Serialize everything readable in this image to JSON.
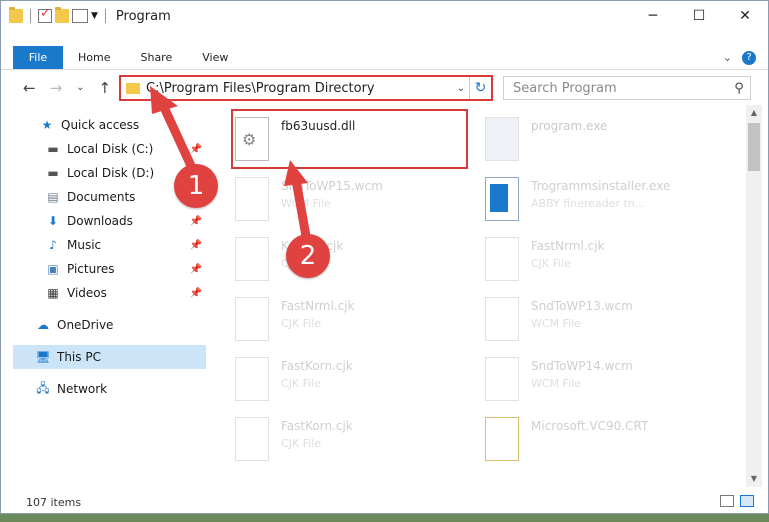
{
  "window": {
    "title": "Program",
    "controls": {
      "minimize": "─",
      "maximize": "☐",
      "close": "✕"
    }
  },
  "ribbon": {
    "tabs": [
      "File",
      "Home",
      "Share",
      "View"
    ],
    "expand_glyph": "⌄",
    "help_glyph": "?"
  },
  "address": {
    "path": "C:\\Program Files\\Program Directory",
    "search_placeholder": "Search Program"
  },
  "sidebar": {
    "items": [
      {
        "label": "Quick access",
        "icon": "star-icon",
        "pinned": false
      },
      {
        "label": "Local Disk (C:)",
        "icon": "drive-icon",
        "pinned": true
      },
      {
        "label": "Local Disk (D:)",
        "icon": "drive-icon",
        "pinned": false
      },
      {
        "label": "Documents",
        "icon": "documents-icon",
        "pinned": true
      },
      {
        "label": "Downloads",
        "icon": "download-icon",
        "pinned": true
      },
      {
        "label": "Music",
        "icon": "music-icon",
        "pinned": true
      },
      {
        "label": "Pictures",
        "icon": "pictures-icon",
        "pinned": true
      },
      {
        "label": "Videos",
        "icon": "videos-icon",
        "pinned": true
      },
      {
        "label": "OneDrive",
        "icon": "cloud-icon",
        "pinned": false
      },
      {
        "label": "This PC",
        "icon": "pc-icon",
        "pinned": false,
        "selected": true
      },
      {
        "label": "Network",
        "icon": "network-icon",
        "pinned": false
      }
    ]
  },
  "files": [
    {
      "name": "fb63uusd.dll",
      "type": "",
      "highlighted": true
    },
    {
      "name": "program.exe",
      "type": ""
    },
    {
      "name": "SndToWP15.wcm",
      "type": "WCM File"
    },
    {
      "name": "Trogrammsinstaller.exe",
      "type": "ABBY finereader tn..."
    },
    {
      "name": "Korean.cjk",
      "type": "CJK File"
    },
    {
      "name": "FastNrml.cjk",
      "type": "CJK File"
    },
    {
      "name": "FastNrml.cjk",
      "type": "CJK File"
    },
    {
      "name": "SndToWP13.wcm",
      "type": "WCM File"
    },
    {
      "name": "FastKorn.cjk",
      "type": "CJK File"
    },
    {
      "name": "SndToWP14.wcm",
      "type": "WCM File"
    },
    {
      "name": "FastKorn.cjk",
      "type": "CJK File"
    },
    {
      "name": "Microsoft.VC90.CRT",
      "type": ""
    }
  ],
  "status": {
    "item_count": "107 items"
  },
  "annotations": {
    "marker1": "1",
    "marker2": "2"
  },
  "colors": {
    "accent": "#1979ca",
    "highlight": "#d93a3a",
    "selection": "#cce4f7"
  }
}
